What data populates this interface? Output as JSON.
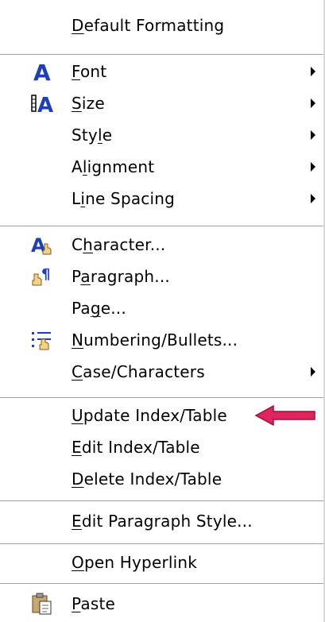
{
  "colors": {
    "icon_blue": "#1f3fb8",
    "icon_hand": "#d9a441",
    "pointer_arrow": "#e0245e"
  },
  "menu": {
    "items": [
      {
        "label": "Default Formatting",
        "u": "D",
        "rest": "efault Formatting",
        "pre": ""
      },
      {
        "label": "Font",
        "u": "F",
        "rest": "ont",
        "pre": "",
        "icon": "font-icon"
      },
      {
        "label": "Size",
        "u": "S",
        "rest": "ize",
        "pre": "",
        "icon": "size-icon"
      },
      {
        "label": "Style",
        "pre": "Sty",
        "u": "l",
        "rest": "e"
      },
      {
        "label": "Alignment",
        "pre": "A",
        "u": "l",
        "rest": "ignment"
      },
      {
        "label": "Line Spacing",
        "pre": "L",
        "u": "i",
        "rest": "ne Spacing"
      },
      {
        "label": "Character...",
        "pre": "C",
        "u": "h",
        "rest": "aracter...",
        "icon": "character-icon"
      },
      {
        "label": "Paragraph...",
        "pre": "P",
        "u": "a",
        "rest": "ragraph...",
        "icon": "paragraph-icon"
      },
      {
        "label": "Page...",
        "pre": "Pa",
        "u": "g",
        "rest": "e..."
      },
      {
        "label": "Numbering/Bullets...",
        "pre": "",
        "u": "N",
        "rest": "umbering/Bullets...",
        "icon": "numbering-bullets-icon"
      },
      {
        "label": "Case/Characters",
        "pre": "",
        "u": "C",
        "rest": "ase/Characters"
      },
      {
        "label": "Update Index/Table",
        "pre": "",
        "u": "U",
        "rest": "pdate Index/Table"
      },
      {
        "label": "Edit Index/Table",
        "pre": "",
        "u": "E",
        "rest": "dit Index/Table"
      },
      {
        "label": "Delete Index/Table",
        "pre": "",
        "u": "D",
        "rest": "elete Index/Table"
      },
      {
        "label": "Edit Paragraph Style...",
        "pre": "",
        "u": "E",
        "rest": "dit Paragraph Style..."
      },
      {
        "label": "Open Hyperlink",
        "pre": "",
        "u": "O",
        "rest": "pen Hyperlink"
      },
      {
        "label": "Paste",
        "pre": "",
        "u": "P",
        "rest": "aste",
        "icon": "paste-icon"
      }
    ]
  }
}
